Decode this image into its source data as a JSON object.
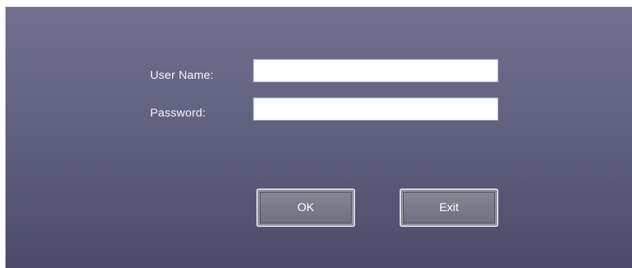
{
  "login_form": {
    "username_label": "User Name:",
    "username_value": "",
    "password_label": "Password:",
    "password_value": "",
    "ok_label": "OK",
    "exit_label": "Exit"
  },
  "colors": {
    "background_top": "#71718f",
    "background_bottom": "#4c4c69",
    "button_face": "#7c7d8b",
    "label_text": "#f4f4f8"
  }
}
